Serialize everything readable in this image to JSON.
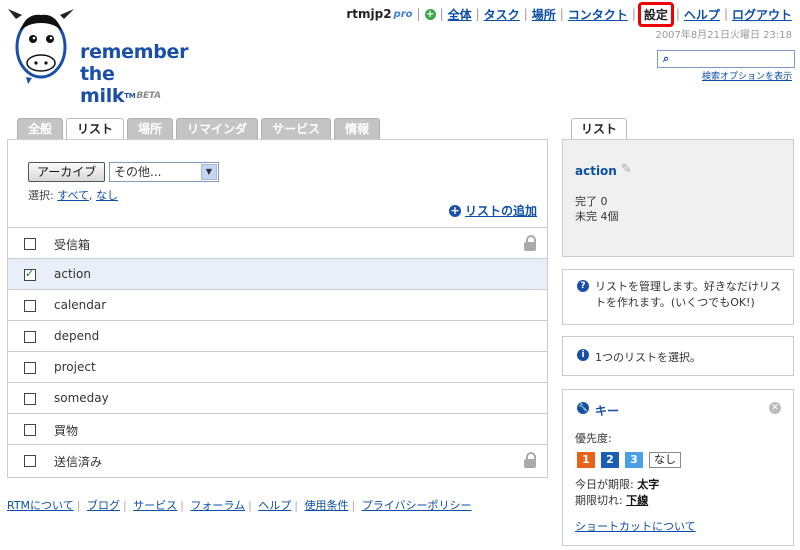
{
  "logo": {
    "line1": "remember",
    "line2": "the milk",
    "tm": "TM",
    "beta": "BETA"
  },
  "topnav": {
    "username": "rtmjp2",
    "pro": "pro",
    "separator": "|",
    "plus_symbol": "+",
    "items": [
      "全体",
      "タスク",
      "場所",
      "コンタクト",
      "設定",
      "ヘルプ",
      "ログアウト"
    ],
    "highlighted": "設定"
  },
  "datetime": "2007年8月21日火曜日 23:18",
  "search": {
    "value": "",
    "placeholder": "",
    "options_link": "検索オプションを表示"
  },
  "tabs": [
    "全般",
    "リスト",
    "場所",
    "リマインダ",
    "サービス",
    "情報"
  ],
  "active_tab": "リスト",
  "controls": {
    "archive_button": "アーカイブ",
    "select_value": "その他...",
    "select_label": "選択:",
    "select_all": "すべて",
    "comma": ",",
    "select_none": "なし",
    "add_list": "リストの追加"
  },
  "lists": [
    {
      "name": "受信箱",
      "checked": false,
      "locked": true
    },
    {
      "name": "action",
      "checked": true,
      "locked": false
    },
    {
      "name": "calendar",
      "checked": false,
      "locked": false
    },
    {
      "name": "depend",
      "checked": false,
      "locked": false
    },
    {
      "name": "project",
      "checked": false,
      "locked": false
    },
    {
      "name": "someday",
      "checked": false,
      "locked": false
    },
    {
      "name": "買物",
      "checked": false,
      "locked": false
    },
    {
      "name": "送信済み",
      "checked": false,
      "locked": true
    }
  ],
  "footer": [
    "RTMについて",
    "ブログ",
    "サービス",
    "フォーラム",
    "ヘルプ",
    "使用条件",
    "プライバシーポリシー"
  ],
  "right": {
    "tab": "リスト",
    "list_name": "action",
    "completed": "完了 0",
    "incomplete": "未完 4個",
    "help1": "リストを管理します。好きなだけリストを作れます。(いくつでもOK!)",
    "help2": "1つのリストを選択。",
    "key_title": "キー",
    "priority_label": "優先度:",
    "priorities": [
      {
        "label": "1",
        "color": "#e8641b"
      },
      {
        "label": "2",
        "color": "#1a5fb4"
      },
      {
        "label": "3",
        "color": "#4aa0e6"
      },
      {
        "label": "なし",
        "color": "#ffffff"
      }
    ],
    "due_today_label": "今日が期限:",
    "due_today_style": "太字",
    "overdue_label": "期限切れ:",
    "overdue_style": "下線",
    "shortcut_link": "ショートカットについて"
  },
  "colors": {
    "link": "#0c4fa6",
    "brand": "#1a4fa8",
    "highlight_border": "#e00000"
  }
}
